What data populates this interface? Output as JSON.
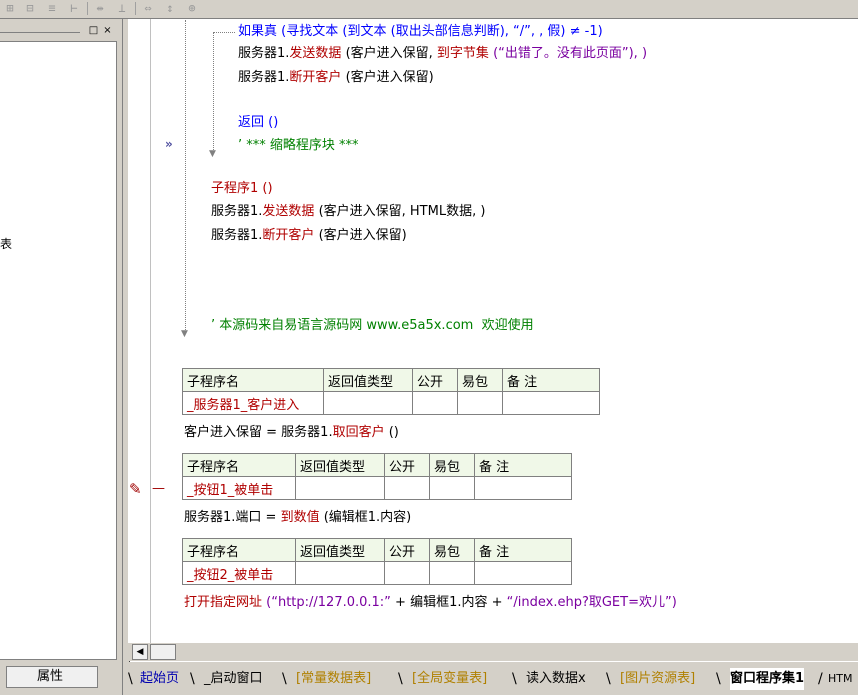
{
  "code": {
    "lines": {
      "if_true": "如果真",
      "if_args_a": "(",
      "find_text": "寻找文本",
      "if_args_b": "(",
      "to_text": "到文本",
      "if_args_c": "(取出头部信息判断), “/”, , 假) ≠ -1)",
      "srv1": "服务器1.",
      "send_data": "发送数据",
      "send_args_a": "(客户进入保留, ",
      "to_bytes": "到字节集",
      "send_args_b": "(“出错了。没有此页面”), )",
      "srv2": "服务器1.",
      "disconnect": "断开客户",
      "disc_args": "(客户进入保留)",
      "return_stmt": "返回 ()",
      "comment_folded": "’ *** 缩略程序块 ***",
      "subcall": "子程序1 ()",
      "srv3": "服务器1.",
      "send_data2": "发送数据",
      "send_args2": "(客户进入保留, HTML数据, )",
      "srv4": "服务器1.",
      "disconnect2": "断开客户",
      "disc_args2": "(客户进入保留)",
      "source_comment": "’ 本源码来自易语言源码网 www.e5a5x.com  欢迎使用"
    },
    "table_headers": {
      "name": "子程序名",
      "return_type": "返回值类型",
      "public": "公开",
      "easy_pkg": "易包",
      "remark": "备 注"
    },
    "sub1": {
      "name": "_服务器1_客户进入",
      "stmt_var": "客户进入保留 = ",
      "stmt_obj": "服务器1.",
      "stmt_fn": "取回客户",
      "stmt_args": " ()"
    },
    "sub2": {
      "name": "_按钮1_被单击",
      "stmt_var": "服务器1.端口 = ",
      "stmt_fn": "到数值",
      "stmt_args": " (编辑框1.内容)"
    },
    "sub3": {
      "name": "_按钮2_被单击",
      "stmt_fn": "打开指定网址",
      "stmt_a": " (“http://127.0.0.1:”",
      "stmt_b": " + 编辑框1.内容 + ",
      "stmt_c": "“/index.ehp?取GET=欢儿”)"
    }
  },
  "left_panel": {
    "partial_char": "表",
    "props_tab": "属性"
  },
  "tabs": [
    {
      "label": "起始页"
    },
    {
      "label": "_启动窗口"
    },
    {
      "label": "[常量数据表]"
    },
    {
      "label": "[全局变量表]"
    },
    {
      "label": "读入数据x"
    },
    {
      "label": "[图片资源表]"
    },
    {
      "label": "窗口程序集1"
    },
    {
      "label": "HTM"
    }
  ],
  "colors": {
    "keyword": "#0000ff",
    "function": "#b00000",
    "comment": "#008000",
    "panel": "#d4d0c8"
  }
}
